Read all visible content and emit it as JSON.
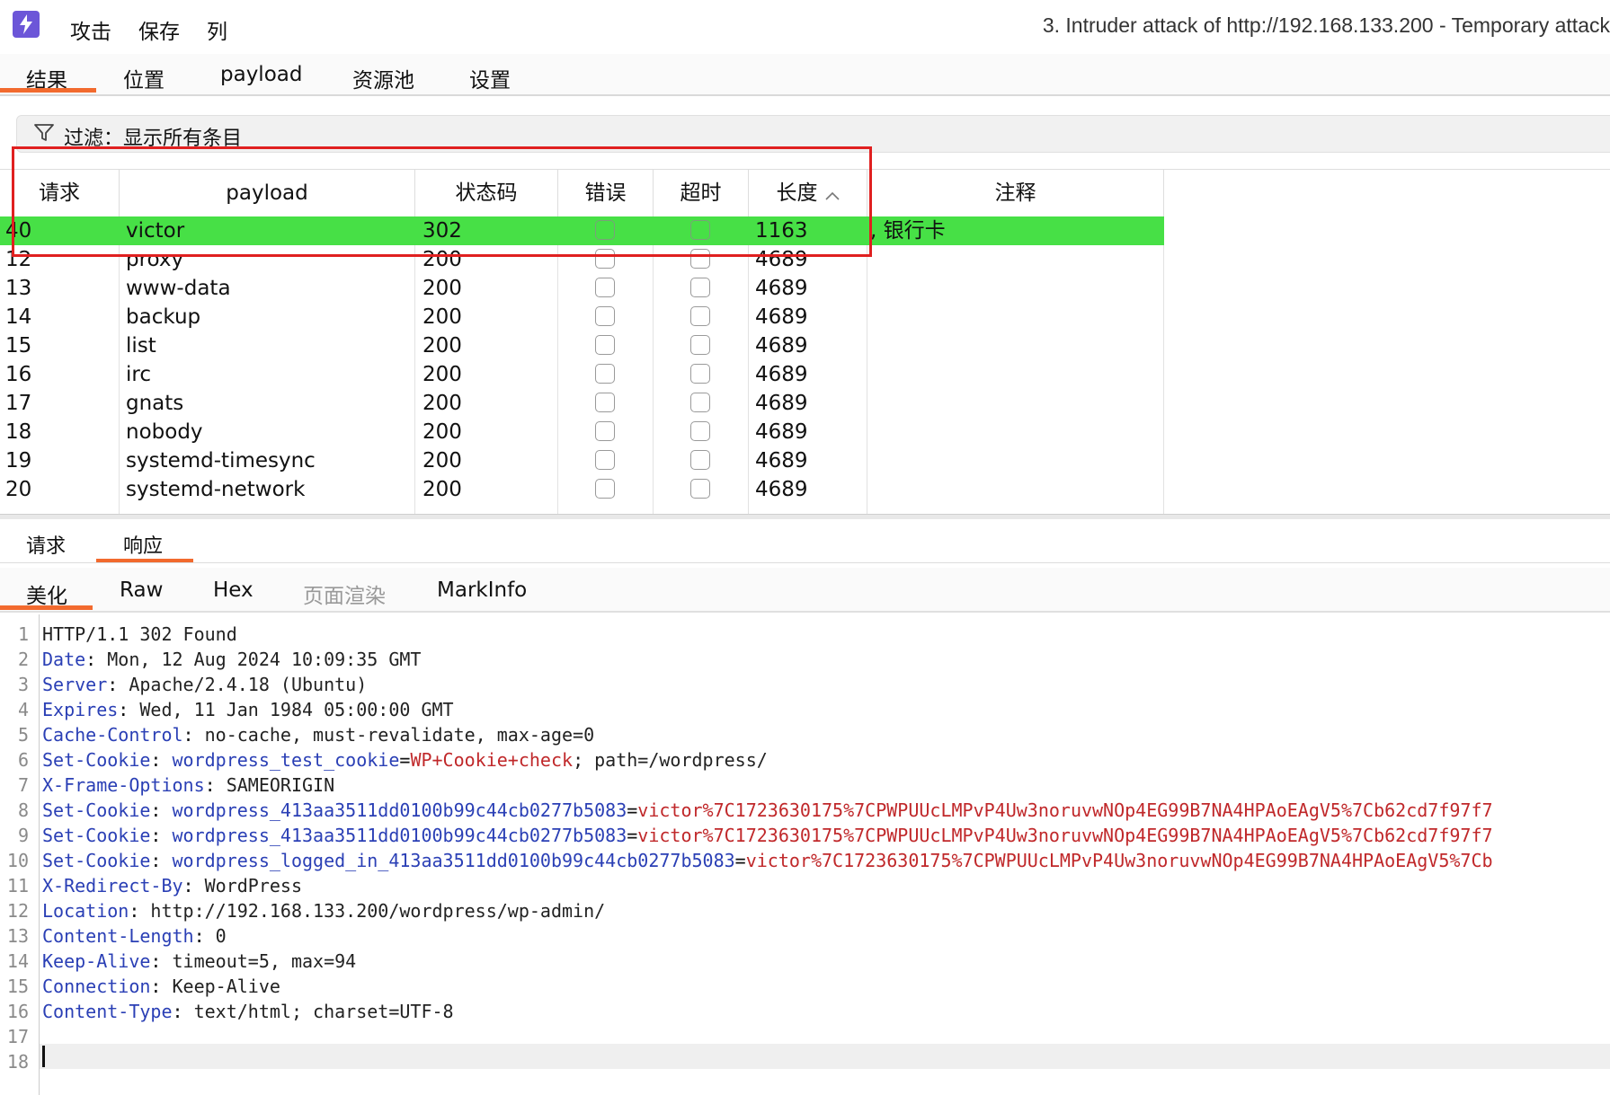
{
  "titlebar": {
    "menu": [
      "攻击",
      "保存",
      "列"
    ],
    "window_title": "3. Intruder attack of http://192.168.133.200 - Temporary attack"
  },
  "top_tabs": [
    "结果",
    "位置",
    "payload",
    "资源池",
    "设置"
  ],
  "filter": {
    "text": "过滤：显示所有条目"
  },
  "table": {
    "headers": [
      "请求",
      "payload",
      "状态码",
      "错误",
      "超时",
      "长度",
      "注释"
    ],
    "rows": [
      {
        "req": "40",
        "payload": "victor",
        "status": "302",
        "length": "1163",
        "comment": ", 银行卡",
        "selected": true
      },
      {
        "req": "12",
        "payload": "proxy",
        "status": "200",
        "length": "4689",
        "comment": ""
      },
      {
        "req": "13",
        "payload": "www-data",
        "status": "200",
        "length": "4689",
        "comment": ""
      },
      {
        "req": "14",
        "payload": "backup",
        "status": "200",
        "length": "4689",
        "comment": ""
      },
      {
        "req": "15",
        "payload": "list",
        "status": "200",
        "length": "4689",
        "comment": ""
      },
      {
        "req": "16",
        "payload": "irc",
        "status": "200",
        "length": "4689",
        "comment": ""
      },
      {
        "req": "17",
        "payload": "gnats",
        "status": "200",
        "length": "4689",
        "comment": ""
      },
      {
        "req": "18",
        "payload": "nobody",
        "status": "200",
        "length": "4689",
        "comment": ""
      },
      {
        "req": "19",
        "payload": "systemd-timesync",
        "status": "200",
        "length": "4689",
        "comment": ""
      },
      {
        "req": "20",
        "payload": "systemd-network",
        "status": "200",
        "length": "4689",
        "comment": ""
      }
    ]
  },
  "bottom_tabs": [
    "请求",
    "响应"
  ],
  "view_tabs": [
    "美化",
    "Raw",
    "Hex",
    "页面渲染",
    "MarkInfo"
  ],
  "colors": {
    "accent": "#f26a2e",
    "selected_row": "#47e046",
    "highlight_box": "#e02020",
    "header_key": "#2a3fb5",
    "cookie_value": "#c0282a"
  },
  "response_lines": [
    {
      "n": "1",
      "plain": "HTTP/1.1 302 Found"
    },
    {
      "n": "2",
      "key": "Date",
      "val": "Mon, 12 Aug 2024 10:09:35 GMT"
    },
    {
      "n": "3",
      "key": "Server",
      "val": "Apache/2.4.18 (Ubuntu)"
    },
    {
      "n": "4",
      "key": "Expires",
      "val": "Wed, 11 Jan 1984 05:00:00 GMT"
    },
    {
      "n": "5",
      "key": "Cache-Control",
      "val": "no-cache, must-revalidate, max-age=0"
    },
    {
      "n": "6",
      "key": "Set-Cookie",
      "cname": "wordpress_test_cookie",
      "cval": "WP+Cookie+check",
      "rest": "; path=/wordpress/"
    },
    {
      "n": "7",
      "key": "X-Frame-Options",
      "val": "SAMEORIGIN"
    },
    {
      "n": "8",
      "key": "Set-Cookie",
      "cname": "wordpress_413aa3511dd0100b99c44cb0277b5083",
      "cval": "victor%7C1723630175%7CPWPUUcLMPvP4Uw3noruvwNOp4EG99B7NA4HPAoEAgV5%7Cb62cd7f97f7",
      "rest": ""
    },
    {
      "n": "9",
      "key": "Set-Cookie",
      "cname": "wordpress_413aa3511dd0100b99c44cb0277b5083",
      "cval": "victor%7C1723630175%7CPWPUUcLMPvP4Uw3noruvwNOp4EG99B7NA4HPAoEAgV5%7Cb62cd7f97f7",
      "rest": ""
    },
    {
      "n": "10",
      "key": "Set-Cookie",
      "cname": "wordpress_logged_in_413aa3511dd0100b99c44cb0277b5083",
      "cval": "victor%7C1723630175%7CPWPUUcLMPvP4Uw3noruvwNOp4EG99B7NA4HPAoEAgV5%7Cb",
      "rest": ""
    },
    {
      "n": "11",
      "key": "X-Redirect-By",
      "val": "WordPress"
    },
    {
      "n": "12",
      "key": "Location",
      "val": "http://192.168.133.200/wordpress/wp-admin/"
    },
    {
      "n": "13",
      "key": "Content-Length",
      "val": "0"
    },
    {
      "n": "14",
      "key": "Keep-Alive",
      "val": "timeout=5, max=94"
    },
    {
      "n": "15",
      "key": "Connection",
      "val": "Keep-Alive"
    },
    {
      "n": "16",
      "key": "Content-Type",
      "val": "text/html; charset=UTF-8"
    },
    {
      "n": "17",
      "plain": ""
    },
    {
      "n": "18",
      "plain": ""
    }
  ]
}
